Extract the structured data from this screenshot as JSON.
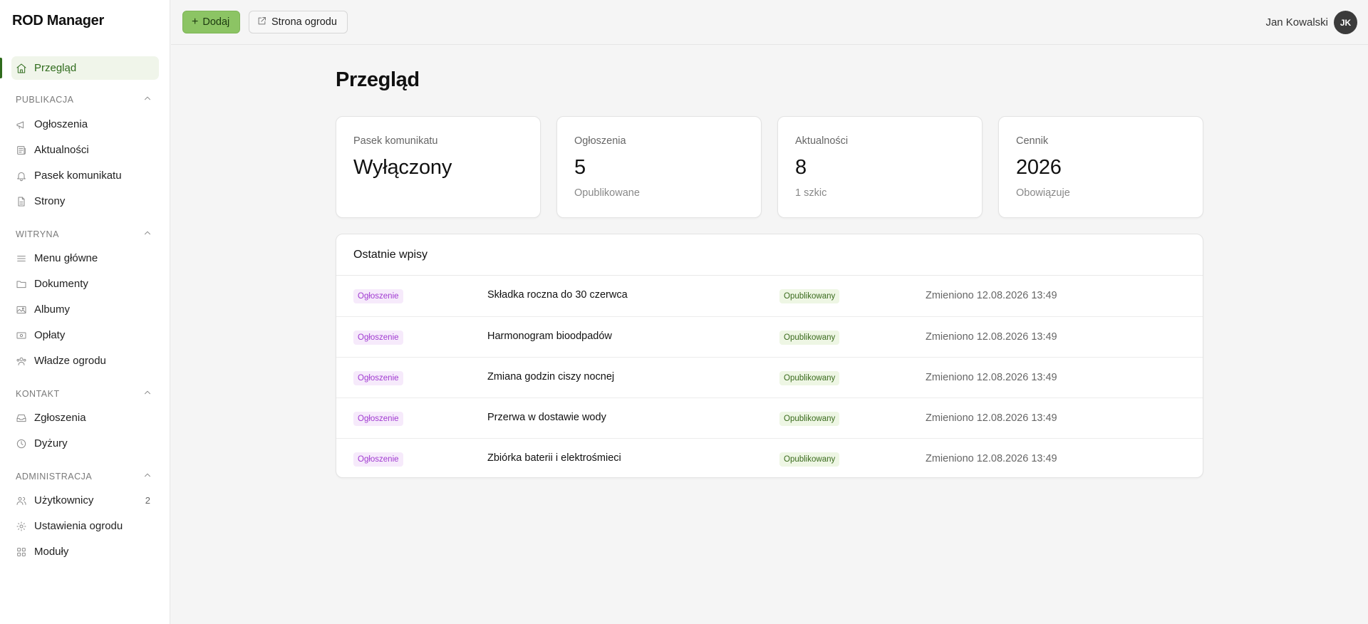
{
  "sidebar": {
    "brand": "ROD Manager",
    "active_item": {
      "label": "Przegląd",
      "icon": "home-icon"
    },
    "sections": [
      {
        "title": "PUBLIKACJA",
        "items": [
          {
            "label": "Ogłoszenia",
            "icon": "megaphone-icon"
          },
          {
            "label": "Aktualności",
            "icon": "newspaper-icon"
          },
          {
            "label": "Pasek komunikatu",
            "icon": "bell-icon"
          },
          {
            "label": "Strony",
            "icon": "file-icon"
          }
        ]
      },
      {
        "title": "WITRYNA",
        "items": [
          {
            "label": "Menu główne",
            "icon": "menu-icon"
          },
          {
            "label": "Dokumenty",
            "icon": "folder-icon"
          },
          {
            "label": "Albumy",
            "icon": "image-icon"
          },
          {
            "label": "Opłaty",
            "icon": "banknote-icon"
          },
          {
            "label": "Władze ogrodu",
            "icon": "users-round-icon"
          }
        ]
      },
      {
        "title": "KONTAKT",
        "items": [
          {
            "label": "Zgłoszenia",
            "icon": "inbox-icon"
          },
          {
            "label": "Dyżury",
            "icon": "clock-icon"
          }
        ]
      },
      {
        "title": "ADMINISTRACJA",
        "items": [
          {
            "label": "Użytkownicy",
            "icon": "users-icon",
            "count": "2"
          },
          {
            "label": "Ustawienia ogrodu",
            "icon": "gear-icon"
          },
          {
            "label": "Moduły",
            "icon": "grid-icon"
          }
        ]
      }
    ]
  },
  "topbar": {
    "add_label": "Dodaj",
    "site_label": "Strona ogrodu",
    "user_name": "Jan Kowalski",
    "user_initials": "JK"
  },
  "main": {
    "title": "Przegląd",
    "cards": [
      {
        "label": "Pasek komunikatu",
        "value": "Wyłączony",
        "sub": ""
      },
      {
        "label": "Ogłoszenia",
        "value": "5",
        "sub": "Opublikowane"
      },
      {
        "label": "Aktualności",
        "value": "8",
        "sub": "1 szkic"
      },
      {
        "label": "Cennik",
        "value": "2026",
        "sub": "Obowiązuje"
      }
    ],
    "recent": {
      "title": "Ostatnie wpisy",
      "rows": [
        {
          "type": "Ogłoszenie",
          "title": "Składka roczna do 30 czerwca",
          "status": "Opublikowany",
          "date": "Zmieniono 12.08.2026 13:49"
        },
        {
          "type": "Ogłoszenie",
          "title": "Harmonogram bioodpadów",
          "status": "Opublikowany",
          "date": "Zmieniono 12.08.2026 13:49"
        },
        {
          "type": "Ogłoszenie",
          "title": "Zmiana godzin ciszy nocnej",
          "status": "Opublikowany",
          "date": "Zmieniono 12.08.2026 13:49"
        },
        {
          "type": "Ogłoszenie",
          "title": "Przerwa w dostawie wody",
          "status": "Opublikowany",
          "date": "Zmieniono 12.08.2026 13:49"
        },
        {
          "type": "Ogłoszenie",
          "title": "Zbiórka baterii i elektrośmieci",
          "status": "Opublikowany",
          "date": "Zmieniono 12.08.2026 13:49"
        }
      ]
    }
  },
  "colors": {
    "accent": "#8cc464",
    "active_text": "#2f6b1c",
    "type_tag": "#a13bd1",
    "status_tag": "#3a6b1d"
  }
}
